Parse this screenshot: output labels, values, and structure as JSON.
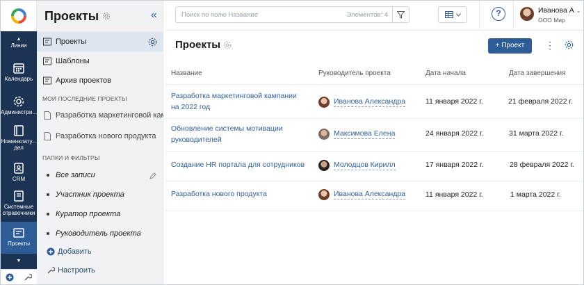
{
  "rail": {
    "items": [
      {
        "label": "Линии"
      },
      {
        "label": "Календарь"
      },
      {
        "label": "Администри..."
      },
      {
        "label": "Номенклату... дел"
      },
      {
        "label": "CRM"
      },
      {
        "label": "Системные справочники"
      },
      {
        "label": "Проекты"
      }
    ]
  },
  "nav": {
    "title": "Проекты",
    "collapse": "«",
    "items": [
      {
        "label": "Проекты"
      },
      {
        "label": "Шаблоны"
      },
      {
        "label": "Архив проектов"
      }
    ],
    "recent_caption": "МОИ ПОСЛЕДНИЕ ПРОЕКТЫ",
    "recent": [
      {
        "label": "Разработка маркетинговой кампа"
      },
      {
        "label": "Разработка нового продукта"
      }
    ],
    "folders_caption": "ПАПКИ И ФИЛЬТРЫ",
    "filters": [
      {
        "label": "Все записи"
      },
      {
        "label": "Участник проекта"
      },
      {
        "label": "Куратор проекта"
      },
      {
        "label": "Руководитель проекта"
      }
    ],
    "add_label": "Добавить",
    "settings_label": "Настроить"
  },
  "topbar": {
    "search_placeholder": "Поиск по полю Название",
    "count_label": "Элементов: 4",
    "help": "?",
    "user_name": "Иванова А",
    "user_org": "ООО Мир"
  },
  "main": {
    "title": "Проекты",
    "add_button": "+ Проект",
    "columns": [
      "Название",
      "Руководитель проекта",
      "Дата начала",
      "Дата завершения"
    ],
    "rows": [
      {
        "name": "Разработка маркетинговой кампании на 2022 год",
        "manager": "Иванова Александра",
        "start": "11 января 2022 г.",
        "end": "21 февраля 2022 г."
      },
      {
        "name": "Обновление системы мотивации руководителей",
        "manager": "Максимова Елена",
        "start": "24 января 2022 г.",
        "end": "31 марта 2022 г."
      },
      {
        "name": "Создание HR портала для сотрудников",
        "manager": "Молодцов Кирилл",
        "start": "17 января 2022 г.",
        "end": "28 февраля 2022 г."
      },
      {
        "name": "Разработка нового продукта",
        "manager": "Иванова Александра",
        "start": "11 января 2022 г.",
        "end": "1 марта 2022 г."
      }
    ]
  },
  "colors": {
    "accent": "#2d5c97",
    "rail": "#1c3353",
    "link": "#2f5f9e"
  }
}
